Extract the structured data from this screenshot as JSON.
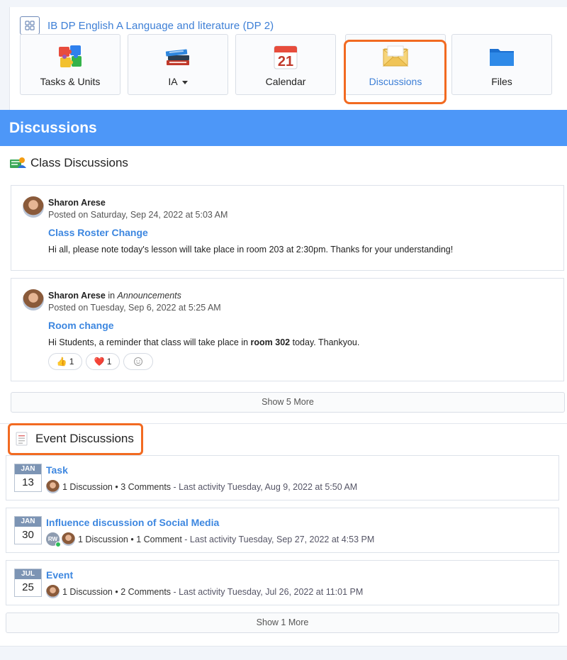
{
  "class_header": {
    "title": "IB DP English A Language and literature (DP 2)",
    "icon": "grid-icon"
  },
  "nav_tiles": [
    {
      "label": "Tasks & Units",
      "icon": "puzzle-icon"
    },
    {
      "label": "IA",
      "icon": "books-icon",
      "has_dropdown": true
    },
    {
      "label": "Calendar",
      "icon": "calendar-icon",
      "calendar_number": "21"
    },
    {
      "label": "Discussions",
      "icon": "envelope-icon",
      "active": true
    },
    {
      "label": "Files",
      "icon": "folder-icon"
    }
  ],
  "banner": {
    "title": "Discussions"
  },
  "class_discussions": {
    "heading": "Class Discussions",
    "posts": [
      {
        "author": "Sharon Arese",
        "posted": "Posted on Saturday, Sep 24, 2022 at 5:03 AM",
        "title": "Class Roster Change",
        "body": "Hi all, please note today's lesson will take place in room 203 at 2:30pm. Thanks for your understanding!"
      },
      {
        "author": "Sharon Arese",
        "in_label": "in",
        "group": "Announcements",
        "posted": "Posted on Tuesday, Sep 6, 2022 at 5:25 AM",
        "title": "Room change",
        "body_before": "Hi Students, a reminder that class will take place in ",
        "body_bold": "room 302",
        "body_after": " today. Thankyou.",
        "reactions": [
          {
            "emoji": "👍",
            "count": "1"
          },
          {
            "emoji": "❤️",
            "count": "1"
          }
        ]
      }
    ],
    "show_more": "Show 5 More"
  },
  "event_discussions": {
    "heading": "Event Discussions",
    "events": [
      {
        "month": "JAN",
        "day": "13",
        "title": "Task",
        "discussions": "1 Discussion",
        "comments": "3 Comments",
        "last_activity": "- Last activity Tuesday, Aug 9, 2022 at 5:50 AM"
      },
      {
        "month": "JAN",
        "day": "30",
        "title": "Influence discussion of Social Media",
        "extra_avatar": "RW",
        "discussions": "1 Discussion",
        "comments": "1 Comment",
        "last_activity": "- Last activity Tuesday, Sep 27, 2022 at 4:53 PM"
      },
      {
        "month": "JUL",
        "day": "25",
        "title": "Event",
        "discussions": "1 Discussion",
        "comments": "2 Comments",
        "last_activity": "- Last activity Tuesday, Jul 26, 2022 at 11:01 PM"
      }
    ],
    "show_more": "Show 1 More"
  },
  "colors": {
    "accent": "#4d97f8",
    "link": "#3d87e0",
    "highlight": "#f26a21"
  }
}
